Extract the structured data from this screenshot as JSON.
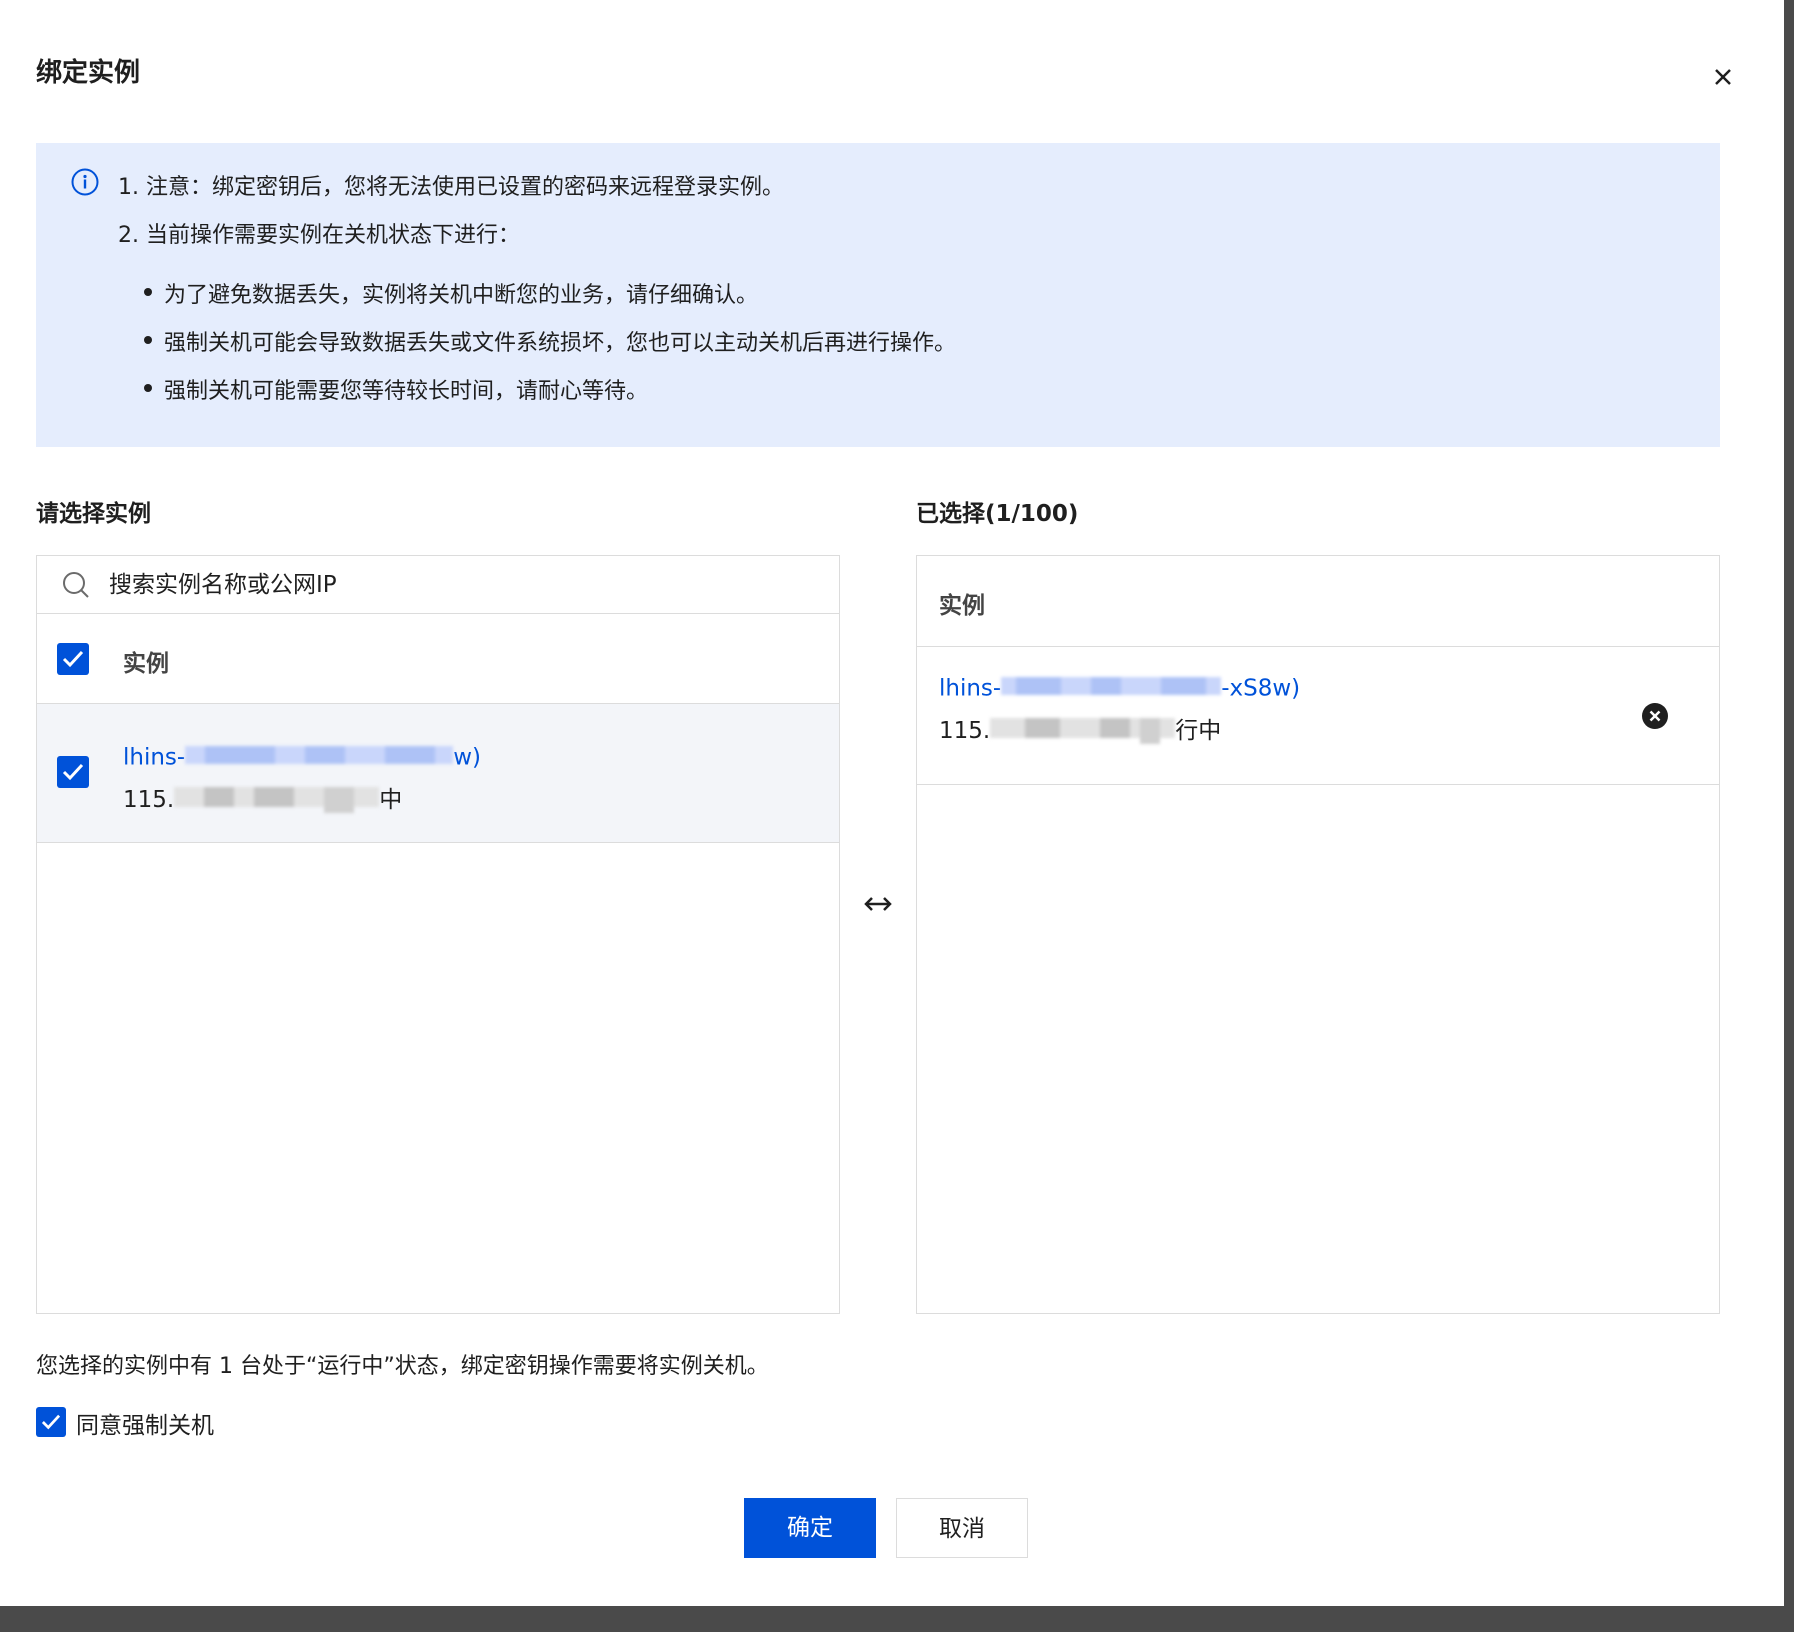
{
  "dialog": {
    "title": "绑定实例"
  },
  "notice": {
    "line1": "1. 注意：绑定密钥后，您将无法使用已设置的密码来远程登录实例。",
    "line2": "2. 当前操作需要实例在关机状态下进行：",
    "bullets": [
      "为了避免数据丢失，实例将关机中断您的业务，请仔细确认。",
      "强制关机可能会导致数据丢失或文件系统损坏，您也可以主动关机后再进行操作。",
      "强制关机可能需要您等待较长时间，请耐心等待。"
    ]
  },
  "left_panel": {
    "title": "请选择实例",
    "search_placeholder": "搜索实例名称或公网IP",
    "column_header": "实例",
    "header_checked": true,
    "rows": [
      {
        "name_prefix": "lhins-",
        "name_suffix": "w)",
        "ip_prefix": "115.",
        "status_suffix": "中",
        "checked": true
      }
    ]
  },
  "right_panel": {
    "title": "已选择(1/100)",
    "column_header": "实例",
    "rows": [
      {
        "name_prefix": "lhins-",
        "name_suffix": "-xS8w)",
        "ip_prefix": "115.",
        "status_suffix": "行中"
      }
    ]
  },
  "footer": {
    "message": "您选择的实例中有 1 台处于“运行中”状态，绑定密钥操作需要将实例关机。",
    "agree_label": "同意强制关机",
    "agree_checked": true,
    "confirm_label": "确定",
    "cancel_label": "取消"
  },
  "colors": {
    "primary": "#0052d9",
    "notice_bg": "#e5edfd",
    "border": "#dcdcdc",
    "selected_row_bg": "#f3f5f9"
  }
}
